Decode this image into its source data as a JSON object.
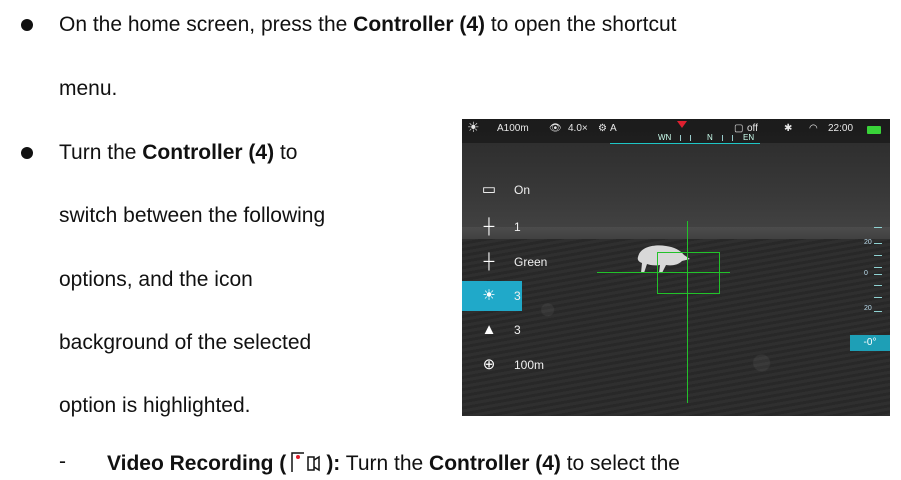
{
  "para1": {
    "line1_pre": "On the home screen, press the ",
    "line1_bold": "Controller (4)",
    "line1_post": " to open the shortcut",
    "line2": "menu."
  },
  "para2": {
    "line1_pre": "Turn the ",
    "line1_bold": "Controller (4)",
    "line1_post": " to",
    "line2": "switch between the following",
    "line3": "options, and the icon",
    "line4": "background of the selected",
    "line5": "option is highlighted."
  },
  "sub": {
    "dash": "-",
    "bold1": "Video Recording (",
    "bold2": "):",
    "mid": " Turn the ",
    "bold3": "Controller (4)",
    "end": " to select the"
  },
  "device": {
    "status": {
      "range": "A100m",
      "zoom": "4.0×",
      "mode": "A",
      "rec": "off",
      "time": "22:00"
    },
    "compass": [
      "WN",
      "N",
      "EN"
    ],
    "menu": [
      {
        "icon": "video-record-icon",
        "label": "On"
      },
      {
        "icon": "reticle-type-icon",
        "label": "1"
      },
      {
        "icon": "reticle-color-icon",
        "label": "Green"
      },
      {
        "icon": "brightness-icon",
        "label": "3",
        "selected": true
      },
      {
        "icon": "contrast-icon",
        "label": "3"
      },
      {
        "icon": "crosshair-icon",
        "label": "100m"
      }
    ],
    "scale_labels": [
      "20",
      "0",
      "20"
    ],
    "angle": "-0°"
  }
}
